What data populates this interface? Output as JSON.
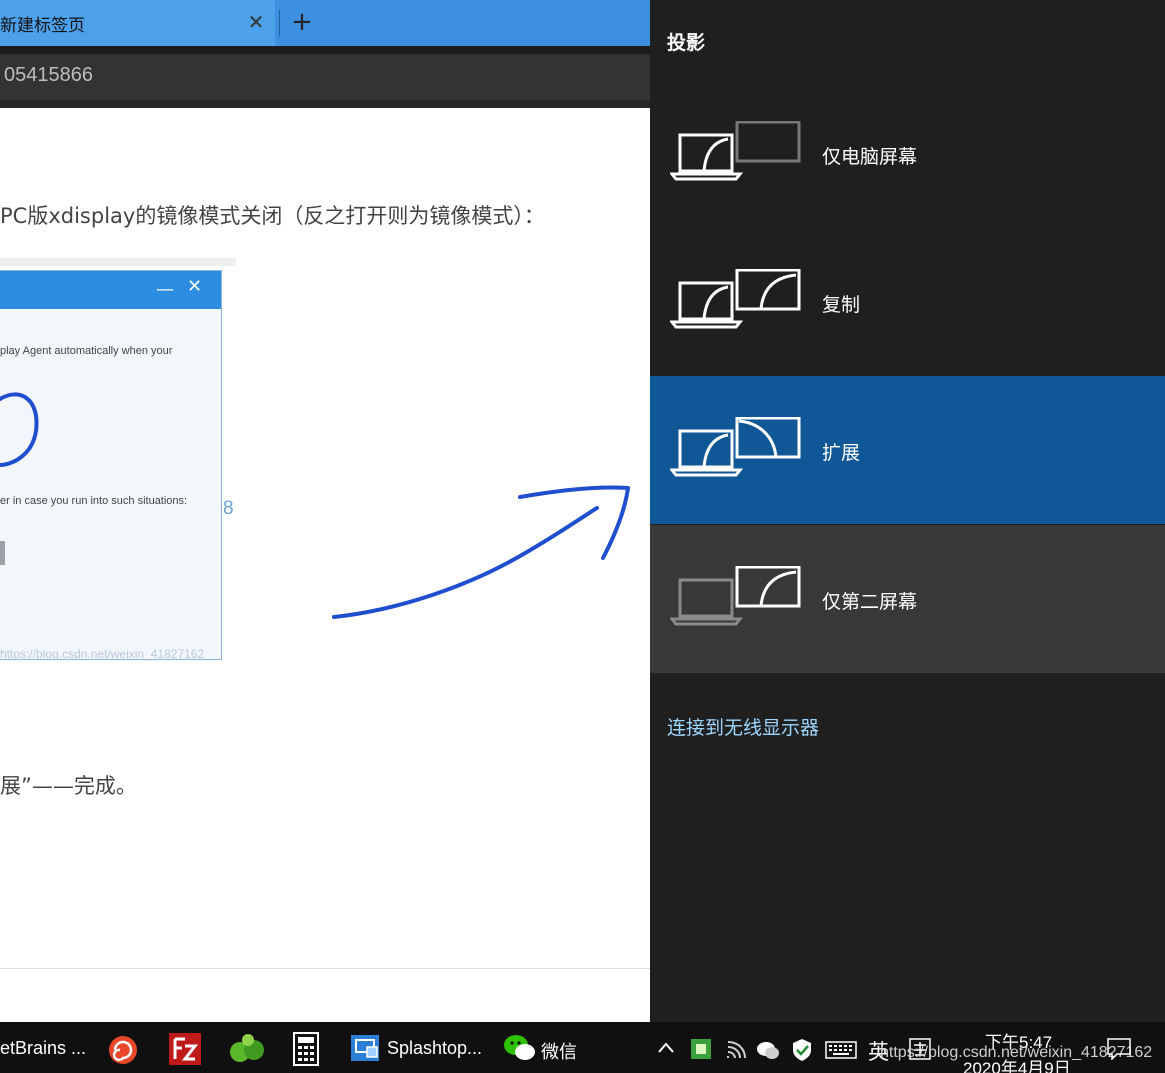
{
  "browser": {
    "tab_title": "新建标签页",
    "tab_close": "✕",
    "new_tab": "+",
    "address": "05415866"
  },
  "page": {
    "para1": "PC版xdisplay的镜像模式关闭（反之打开则为镜像模式）：",
    "dialog_minimize": "—",
    "dialog_close": "✕",
    "dialog_text1": "play Agent automatically when your",
    "dialog_text2": "er in case you run into such situations:",
    "dialog_watermark": "https://blog.csdn.net/weixin_41827162",
    "outside_digit": "8",
    "para2": "展”——完成。"
  },
  "project_panel": {
    "title": "投影",
    "options": [
      {
        "label": "仅电脑屏幕",
        "state": "normal"
      },
      {
        "label": "复制",
        "state": "normal"
      },
      {
        "label": "扩展",
        "state": "selected"
      },
      {
        "label": "仅第二屏幕",
        "state": "hover"
      }
    ],
    "wireless_link": "连接到无线显示器"
  },
  "taskbar": {
    "jetbrains_label": "etBrains ...",
    "splashtop_label": "Splashtop...",
    "wechat_label": "微信",
    "ime_lang": "英",
    "time": "下午5:47",
    "date": "2020年4月9日",
    "watermark": "https://blog.csdn.net/weixin_41827162"
  },
  "colors": {
    "accent_selected": "#0f5796",
    "panel_bg": "#1f1f1f",
    "annotation_ink": "#1f4fcf"
  }
}
